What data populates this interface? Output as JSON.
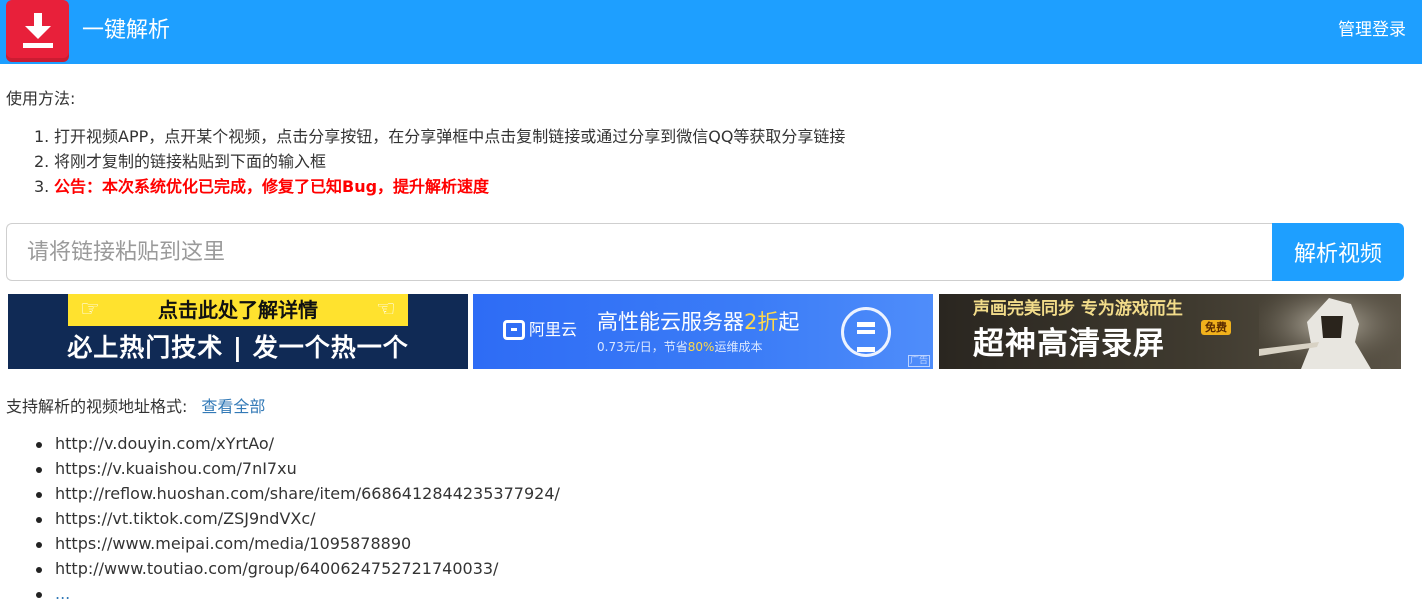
{
  "header": {
    "title": "一键解析",
    "admin_login": "管理登录"
  },
  "usage": {
    "heading": "使用方法:",
    "steps": [
      {
        "num": "1.",
        "text": "打开视频APP，点开某个视频，点击分享按钮，在分享弹框中点击复制链接或通过分享到微信QQ等获取分享链接"
      },
      {
        "num": "2.",
        "text": "将刚才复制的链接粘贴到下面的输入框"
      },
      {
        "num": "3.",
        "text": "公告：本次系统优化已完成，修复了已知Bug，提升解析速度"
      }
    ]
  },
  "search": {
    "placeholder": "请将链接粘贴到这里",
    "button_label": "解析视频"
  },
  "ads": [
    {
      "top_text": "点击此处了解详情",
      "bottom_text": "必上热门技术 | 发一个热一个"
    },
    {
      "brand": "阿里云",
      "headline_pre": "高性能云服务器",
      "headline_hl": "2折",
      "headline_post": "起",
      "sub_pre": "0.73元/日，节省",
      "sub_hl": "80%",
      "sub_post": "运维成本",
      "ad_label": "广告"
    },
    {
      "top_text": "声画完美同步 专为游戏而生",
      "big_text": "超神高清录屏",
      "tag": "免费"
    }
  ],
  "supported": {
    "label": "支持解析的视频地址格式:",
    "view_all": "查看全部",
    "urls": [
      "http://v.douyin.com/xYrtAo/",
      "https://v.kuaishou.com/7nI7xu",
      "http://reflow.huoshan.com/share/item/6686412844235377924/",
      "https://vt.tiktok.com/ZSJ9ndVXc/",
      "https://www.meipai.com/media/1095878890",
      "http://www.toutiao.com/group/6400624752721740033/"
    ],
    "more": "..."
  },
  "colors": {
    "header_bg": "#1e9fff",
    "logo_bg": "#e8203a",
    "notice_red": "#ff0000",
    "link_blue": "#337ab7"
  },
  "icons": {
    "logo": "download-arrow-icon"
  }
}
